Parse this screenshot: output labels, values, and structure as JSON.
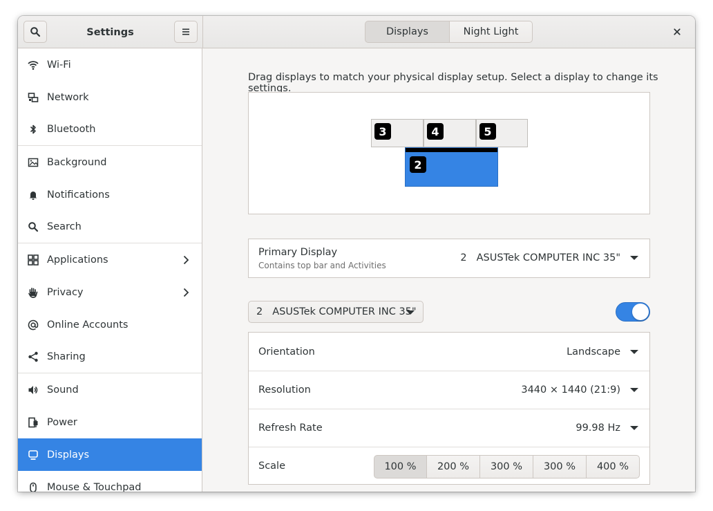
{
  "header": {
    "app_title": "Settings",
    "tabs": [
      {
        "label": "Displays",
        "active": true
      },
      {
        "label": "Night Light",
        "active": false
      }
    ]
  },
  "sidebar": {
    "items": [
      {
        "label": "Wi-Fi",
        "icon": "wifi-icon"
      },
      {
        "label": "Network",
        "icon": "network-icon"
      },
      {
        "label": "Bluetooth",
        "icon": "bluetooth-icon"
      },
      {
        "label": "Background",
        "icon": "background-icon"
      },
      {
        "label": "Notifications",
        "icon": "bell-icon"
      },
      {
        "label": "Search",
        "icon": "search-icon"
      },
      {
        "label": "Applications",
        "icon": "apps-grid-icon",
        "has_submenu": true
      },
      {
        "label": "Privacy",
        "icon": "hand-icon",
        "has_submenu": true
      },
      {
        "label": "Online Accounts",
        "icon": "at-sign-icon"
      },
      {
        "label": "Sharing",
        "icon": "share-icon"
      },
      {
        "label": "Sound",
        "icon": "speaker-icon"
      },
      {
        "label": "Power",
        "icon": "power-plug-icon"
      },
      {
        "label": "Displays",
        "icon": "monitor-icon",
        "active": true
      },
      {
        "label": "Mouse & Touchpad",
        "icon": "mouse-icon"
      }
    ]
  },
  "displays": {
    "description": "Drag displays to match your physical display setup. Select a display to change its settings.",
    "arrangement": {
      "monitors": [
        {
          "number": "3"
        },
        {
          "number": "4"
        },
        {
          "number": "5"
        },
        {
          "number": "2",
          "primary": true
        }
      ]
    },
    "primary_display": {
      "label": "Primary Display",
      "sublabel": "Contains top bar and Activities",
      "value_index": "2",
      "value_name": "ASUSTek COMPUTER INC 35\""
    },
    "monitor_selector": {
      "index": "2",
      "name": "ASUSTek COMPUTER INC 35\""
    },
    "monitor_enabled": true,
    "settings": {
      "orientation_label": "Orientation",
      "orientation_value": "Landscape",
      "resolution_label": "Resolution",
      "resolution_value": "3440 × 1440 (21:9)",
      "refresh_label": "Refresh Rate",
      "refresh_value": "99.98 Hz",
      "scale_label": "Scale",
      "scale_options": [
        "100 %",
        "200 %",
        "300 %",
        "300 %",
        "400 %"
      ]
    }
  },
  "colors": {
    "accent": "#3584e4",
    "window_bg": "#f6f5f4",
    "sidebar_bg": "#ffffff",
    "text": "#2e3436"
  }
}
